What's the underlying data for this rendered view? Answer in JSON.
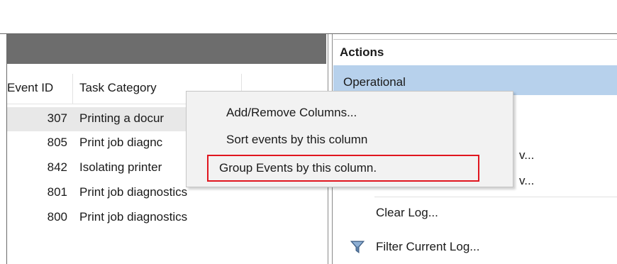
{
  "events_pane": {
    "columns": [
      "Event ID",
      "Task Category"
    ],
    "rows": [
      {
        "event_id": "307",
        "task_category": "Printing a docur"
      },
      {
        "event_id": "805",
        "task_category": "Print job diagnc"
      },
      {
        "event_id": "842",
        "task_category": "Isolating printer"
      },
      {
        "event_id": "801",
        "task_category": "Print job diagnostics"
      },
      {
        "event_id": "800",
        "task_category": "Print job diagnostics"
      }
    ]
  },
  "actions_pane": {
    "title": "Actions",
    "group": "Operational",
    "partial_labels": [
      "v...",
      "v..."
    ],
    "items": [
      {
        "label": "Clear Log...",
        "icon": "none"
      },
      {
        "label": "Filter Current Log...",
        "icon": "filter-funnel-icon"
      }
    ]
  },
  "context_menu": {
    "items": [
      "Add/Remove Columns...",
      "Sort events by this column",
      "Group Events by this column."
    ],
    "highlighted_item": "Group Events by this column.",
    "highlight_color": "#e0161f"
  },
  "colors": {
    "header_bar": "#6d6d6d",
    "selected_row": "#e8e8e8",
    "operational_bar": "#b7d1ec",
    "menu_bg": "#f2f2f2"
  }
}
